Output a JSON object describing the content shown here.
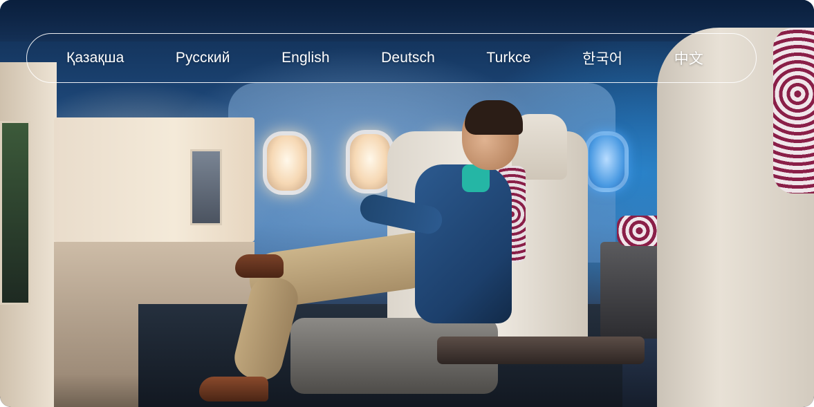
{
  "languages": [
    {
      "code": "kk",
      "label": "Қазақша"
    },
    {
      "code": "ru",
      "label": "Русский"
    },
    {
      "code": "en",
      "label": "English"
    },
    {
      "code": "de",
      "label": "Deutsch"
    },
    {
      "code": "tr",
      "label": "Turkce"
    },
    {
      "code": "ko",
      "label": "한국어"
    },
    {
      "code": "zh",
      "label": "中文"
    }
  ],
  "colors": {
    "nav_text": "#ffffff",
    "nav_border": "#ffffff",
    "accent_pattern": "#8a1f48",
    "cabin_blue": "#1f4b7e"
  }
}
